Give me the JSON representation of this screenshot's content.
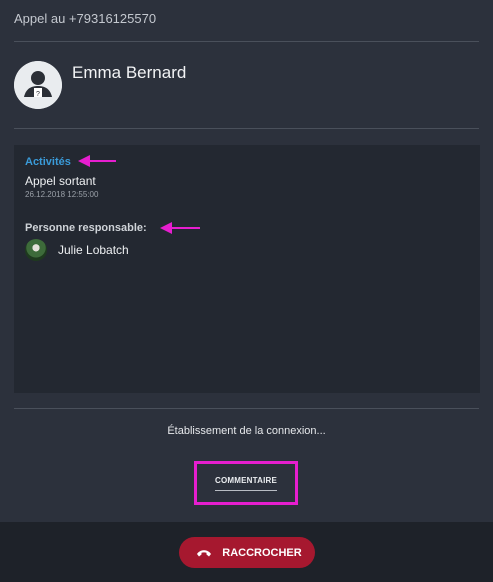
{
  "header": {
    "title": "Appel au +79316125570"
  },
  "contact": {
    "name": "Emma Bernard"
  },
  "activity": {
    "heading": "Activités",
    "call_type": "Appel sortant",
    "call_date": "26.12.2018 12:55:00",
    "responsible_heading": "Personne responsable:",
    "responsible_name": "Julie Lobatch"
  },
  "status": {
    "text": "Établissement de la connexion..."
  },
  "actions": {
    "comment_label": "COMMENTAIRE",
    "hangup_label": "RACCROCHER"
  },
  "colors": {
    "accent_blue": "#3a9bd9",
    "annotation_magenta": "#e61ecf",
    "hangup_red": "#a6182f"
  }
}
